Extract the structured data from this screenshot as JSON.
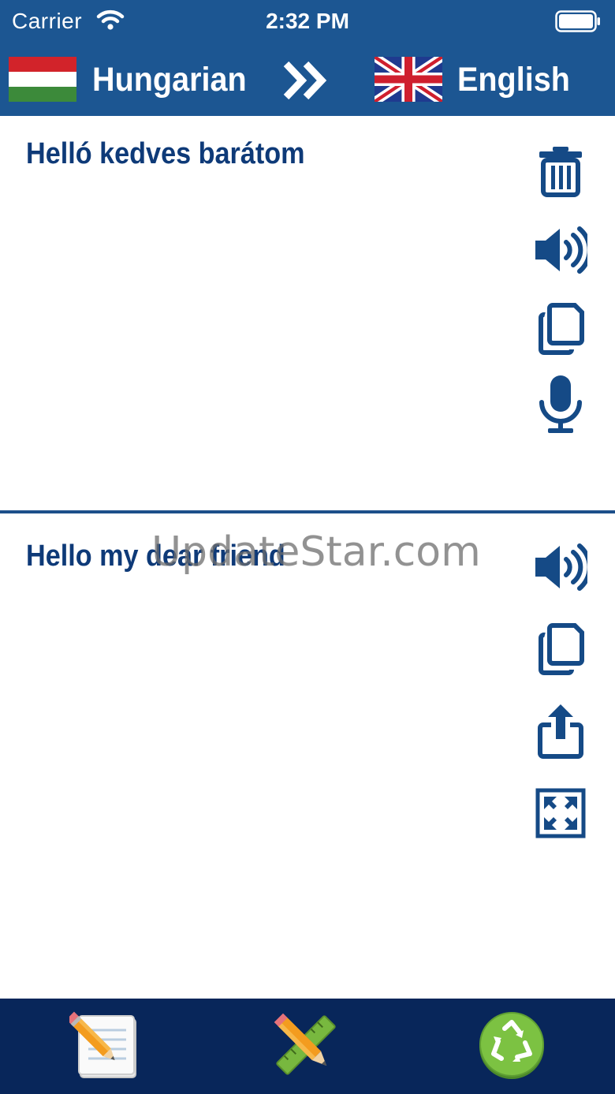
{
  "status_bar": {
    "carrier": "Carrier",
    "time": "2:32 PM",
    "wifi_icon": "wifi-icon",
    "battery_icon": "battery-icon"
  },
  "header": {
    "source_language": "Hungarian",
    "target_language": "English",
    "source_flag": "hungary-flag-icon",
    "target_flag": "uk-flag-icon",
    "swap_icon": "double-chevron-right-icon"
  },
  "source_panel": {
    "text": "Helló kedves barátom",
    "actions": [
      "trash-icon",
      "speaker-icon",
      "copy-icon",
      "microphone-icon"
    ]
  },
  "target_panel": {
    "text": "Hello my dear friend",
    "actions": [
      "speaker-icon",
      "copy-icon",
      "share-icon",
      "fullscreen-icon"
    ]
  },
  "watermark": "UpdateStar.com",
  "tab_bar": {
    "items": [
      "notes-icon",
      "pencil-ruler-icon",
      "recycle-icon"
    ]
  },
  "colors": {
    "header_blue": "#1c5692",
    "text_blue": "#0e3a78",
    "tab_bar_navy": "#08265a",
    "icon_blue": "#154a86"
  }
}
